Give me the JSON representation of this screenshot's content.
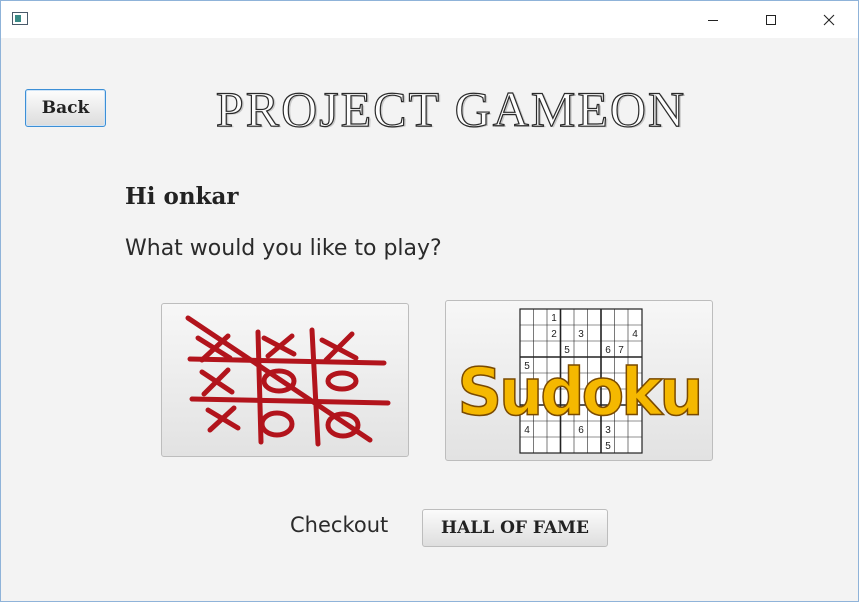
{
  "window": {
    "icon": "app-window-icon",
    "controls": [
      "minimize-icon",
      "maximize-icon",
      "close-icon"
    ]
  },
  "header": {
    "back_label": "Back",
    "title": "PROJECT GAMEON"
  },
  "main": {
    "greeting": "Hi onkar",
    "prompt": "What would you like to play?",
    "games": [
      {
        "name": "tic-tac-toe",
        "icon": "tic-tac-toe-image"
      },
      {
        "name": "sudoku",
        "icon": "sudoku-image",
        "logo_text": "Sudoku"
      }
    ]
  },
  "footer": {
    "checkout_label": "Checkout",
    "hall_of_fame_label": "HALL OF FAME"
  },
  "colors": {
    "ttt_red": "#b2141c",
    "sudoku_gold": "#f5b800",
    "accent_blue": "#3c8fd6"
  }
}
